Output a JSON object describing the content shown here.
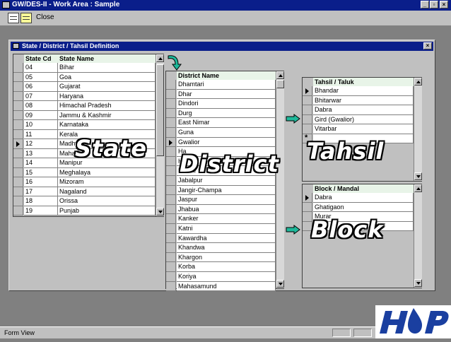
{
  "app": {
    "title": "GW/DES-II - Work Area : Sample"
  },
  "toolbar": {
    "close_label": "Close"
  },
  "form": {
    "title": "State / District / Tahsil Definition"
  },
  "state_grid": {
    "headers": [
      "State Cd",
      "State Name"
    ],
    "rows": [
      [
        "04",
        "Bihar"
      ],
      [
        "05",
        "Goa"
      ],
      [
        "06",
        "Gujarat"
      ],
      [
        "07",
        "Haryana"
      ],
      [
        "08",
        "Himachal Pradesh"
      ],
      [
        "09",
        "Jammu & Kashmir"
      ],
      [
        "10",
        "Karnataka"
      ],
      [
        "11",
        "Kerala"
      ],
      [
        "12",
        "Madhya"
      ],
      [
        "13",
        "Mahar"
      ],
      [
        "14",
        "Manipur"
      ],
      [
        "15",
        "Meghalaya"
      ],
      [
        "16",
        "Mizoram"
      ],
      [
        "17",
        "Nagaland"
      ],
      [
        "18",
        "Orissa"
      ],
      [
        "19",
        "Punjab"
      ]
    ],
    "selected_index": 8
  },
  "district_grid": {
    "header": "District Name",
    "rows": [
      "Dhamtari",
      "Dhar",
      "Dindori",
      "Durg",
      "East Nimar",
      "Guna",
      "Gwalior",
      "Ha",
      "H",
      "Indore",
      "Jabalpur",
      "Jangir-Champa",
      "Jaspur",
      "Jhabua",
      "Kanker",
      "Katni",
      "Kawardha",
      "Khandwa",
      "Khargon",
      "Korba",
      "Koriya",
      "Mahasamund"
    ],
    "selected_index": 6
  },
  "tahsil_grid": {
    "header": "Tahsil / Taluk",
    "rows": [
      "Bhandar",
      "Bhitarwar",
      "Dabra",
      "Gird (Gwalior)",
      "Vitarbar"
    ],
    "new_record_marker": "*"
  },
  "block_grid": {
    "header": "Block / Mandal",
    "rows": [
      "Dabra",
      "Ghatigaon",
      "Murar"
    ]
  },
  "overlays": {
    "state": "State",
    "district": "District",
    "tahsil": "Tahsil",
    "block": "Block"
  },
  "status_bar": {
    "text": "Form View"
  },
  "logo": {
    "text": "HP"
  },
  "colors": {
    "title_bar": "#0a1e8a",
    "header_bg": "#e8f4e8",
    "arrow": "#1fb89a",
    "logo_blue": "#1a3fa0"
  }
}
